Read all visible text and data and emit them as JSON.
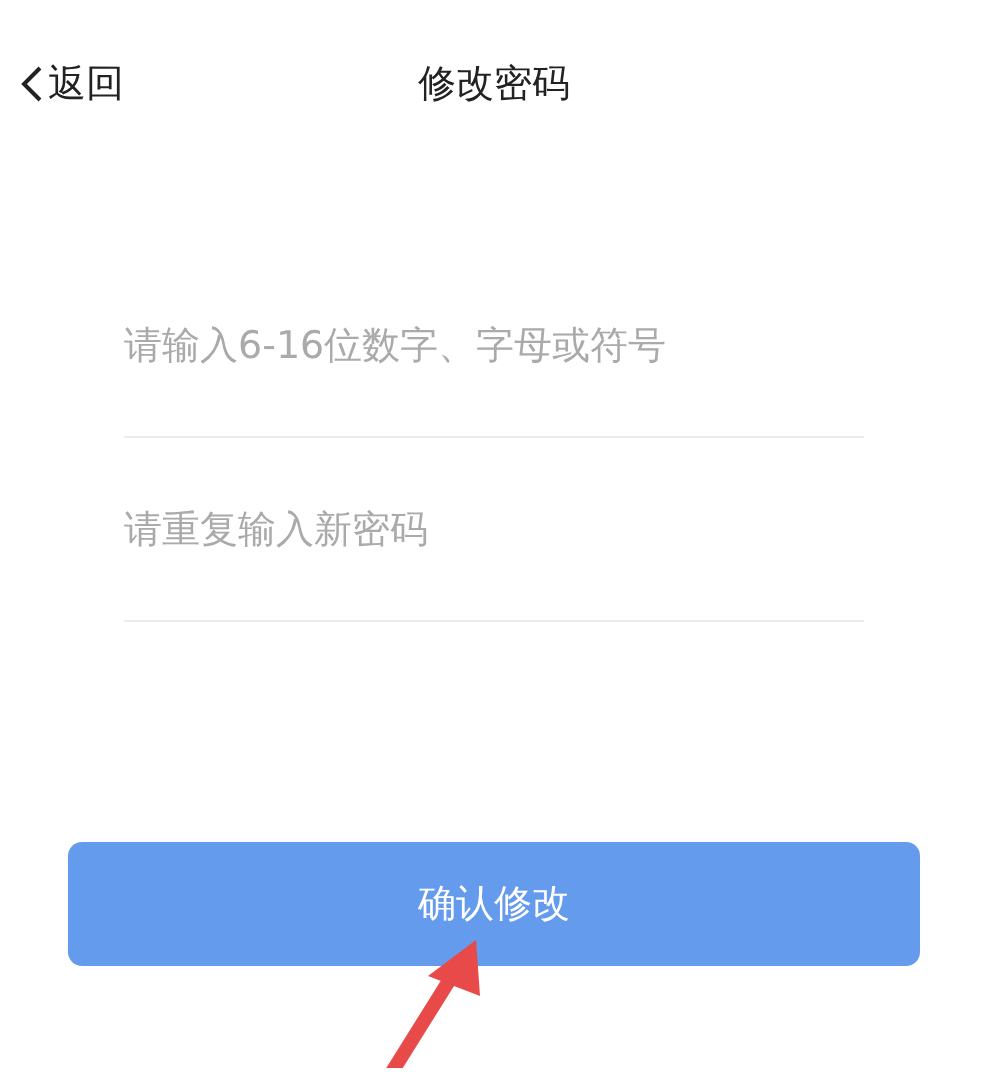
{
  "nav": {
    "back": "返回",
    "title": "修改密码"
  },
  "fields": [
    {
      "placeholder": "请输入6-16位数字、字母或符号"
    },
    {
      "placeholder": "请重复输入新密码"
    }
  ],
  "button": {
    "label": "确认修改"
  }
}
